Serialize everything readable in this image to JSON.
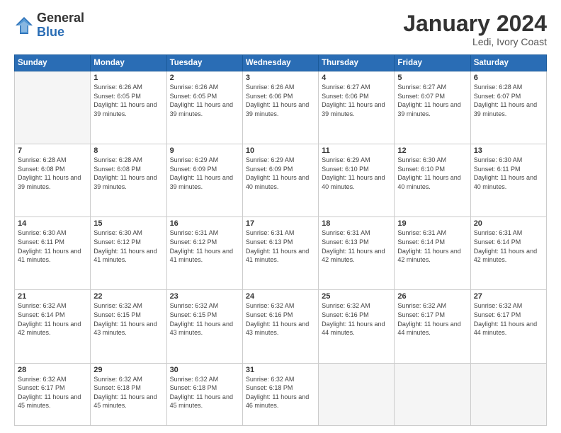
{
  "header": {
    "logo_general": "General",
    "logo_blue": "Blue",
    "month_title": "January 2024",
    "location": "Ledi, Ivory Coast"
  },
  "weekdays": [
    "Sunday",
    "Monday",
    "Tuesday",
    "Wednesday",
    "Thursday",
    "Friday",
    "Saturday"
  ],
  "weeks": [
    [
      {
        "day": "",
        "empty": true
      },
      {
        "day": "1",
        "sunrise": "Sunrise: 6:26 AM",
        "sunset": "Sunset: 6:05 PM",
        "daylight": "Daylight: 11 hours and 39 minutes."
      },
      {
        "day": "2",
        "sunrise": "Sunrise: 6:26 AM",
        "sunset": "Sunset: 6:05 PM",
        "daylight": "Daylight: 11 hours and 39 minutes."
      },
      {
        "day": "3",
        "sunrise": "Sunrise: 6:26 AM",
        "sunset": "Sunset: 6:06 PM",
        "daylight": "Daylight: 11 hours and 39 minutes."
      },
      {
        "day": "4",
        "sunrise": "Sunrise: 6:27 AM",
        "sunset": "Sunset: 6:06 PM",
        "daylight": "Daylight: 11 hours and 39 minutes."
      },
      {
        "day": "5",
        "sunrise": "Sunrise: 6:27 AM",
        "sunset": "Sunset: 6:07 PM",
        "daylight": "Daylight: 11 hours and 39 minutes."
      },
      {
        "day": "6",
        "sunrise": "Sunrise: 6:28 AM",
        "sunset": "Sunset: 6:07 PM",
        "daylight": "Daylight: 11 hours and 39 minutes."
      }
    ],
    [
      {
        "day": "7",
        "sunrise": "Sunrise: 6:28 AM",
        "sunset": "Sunset: 6:08 PM",
        "daylight": "Daylight: 11 hours and 39 minutes."
      },
      {
        "day": "8",
        "sunrise": "Sunrise: 6:28 AM",
        "sunset": "Sunset: 6:08 PM",
        "daylight": "Daylight: 11 hours and 39 minutes."
      },
      {
        "day": "9",
        "sunrise": "Sunrise: 6:29 AM",
        "sunset": "Sunset: 6:09 PM",
        "daylight": "Daylight: 11 hours and 39 minutes."
      },
      {
        "day": "10",
        "sunrise": "Sunrise: 6:29 AM",
        "sunset": "Sunset: 6:09 PM",
        "daylight": "Daylight: 11 hours and 40 minutes."
      },
      {
        "day": "11",
        "sunrise": "Sunrise: 6:29 AM",
        "sunset": "Sunset: 6:10 PM",
        "daylight": "Daylight: 11 hours and 40 minutes."
      },
      {
        "day": "12",
        "sunrise": "Sunrise: 6:30 AM",
        "sunset": "Sunset: 6:10 PM",
        "daylight": "Daylight: 11 hours and 40 minutes."
      },
      {
        "day": "13",
        "sunrise": "Sunrise: 6:30 AM",
        "sunset": "Sunset: 6:11 PM",
        "daylight": "Daylight: 11 hours and 40 minutes."
      }
    ],
    [
      {
        "day": "14",
        "sunrise": "Sunrise: 6:30 AM",
        "sunset": "Sunset: 6:11 PM",
        "daylight": "Daylight: 11 hours and 41 minutes."
      },
      {
        "day": "15",
        "sunrise": "Sunrise: 6:30 AM",
        "sunset": "Sunset: 6:12 PM",
        "daylight": "Daylight: 11 hours and 41 minutes."
      },
      {
        "day": "16",
        "sunrise": "Sunrise: 6:31 AM",
        "sunset": "Sunset: 6:12 PM",
        "daylight": "Daylight: 11 hours and 41 minutes."
      },
      {
        "day": "17",
        "sunrise": "Sunrise: 6:31 AM",
        "sunset": "Sunset: 6:13 PM",
        "daylight": "Daylight: 11 hours and 41 minutes."
      },
      {
        "day": "18",
        "sunrise": "Sunrise: 6:31 AM",
        "sunset": "Sunset: 6:13 PM",
        "daylight": "Daylight: 11 hours and 42 minutes."
      },
      {
        "day": "19",
        "sunrise": "Sunrise: 6:31 AM",
        "sunset": "Sunset: 6:14 PM",
        "daylight": "Daylight: 11 hours and 42 minutes."
      },
      {
        "day": "20",
        "sunrise": "Sunrise: 6:31 AM",
        "sunset": "Sunset: 6:14 PM",
        "daylight": "Daylight: 11 hours and 42 minutes."
      }
    ],
    [
      {
        "day": "21",
        "sunrise": "Sunrise: 6:32 AM",
        "sunset": "Sunset: 6:14 PM",
        "daylight": "Daylight: 11 hours and 42 minutes."
      },
      {
        "day": "22",
        "sunrise": "Sunrise: 6:32 AM",
        "sunset": "Sunset: 6:15 PM",
        "daylight": "Daylight: 11 hours and 43 minutes."
      },
      {
        "day": "23",
        "sunrise": "Sunrise: 6:32 AM",
        "sunset": "Sunset: 6:15 PM",
        "daylight": "Daylight: 11 hours and 43 minutes."
      },
      {
        "day": "24",
        "sunrise": "Sunrise: 6:32 AM",
        "sunset": "Sunset: 6:16 PM",
        "daylight": "Daylight: 11 hours and 43 minutes."
      },
      {
        "day": "25",
        "sunrise": "Sunrise: 6:32 AM",
        "sunset": "Sunset: 6:16 PM",
        "daylight": "Daylight: 11 hours and 44 minutes."
      },
      {
        "day": "26",
        "sunrise": "Sunrise: 6:32 AM",
        "sunset": "Sunset: 6:17 PM",
        "daylight": "Daylight: 11 hours and 44 minutes."
      },
      {
        "day": "27",
        "sunrise": "Sunrise: 6:32 AM",
        "sunset": "Sunset: 6:17 PM",
        "daylight": "Daylight: 11 hours and 44 minutes."
      }
    ],
    [
      {
        "day": "28",
        "sunrise": "Sunrise: 6:32 AM",
        "sunset": "Sunset: 6:17 PM",
        "daylight": "Daylight: 11 hours and 45 minutes."
      },
      {
        "day": "29",
        "sunrise": "Sunrise: 6:32 AM",
        "sunset": "Sunset: 6:18 PM",
        "daylight": "Daylight: 11 hours and 45 minutes."
      },
      {
        "day": "30",
        "sunrise": "Sunrise: 6:32 AM",
        "sunset": "Sunset: 6:18 PM",
        "daylight": "Daylight: 11 hours and 45 minutes."
      },
      {
        "day": "31",
        "sunrise": "Sunrise: 6:32 AM",
        "sunset": "Sunset: 6:18 PM",
        "daylight": "Daylight: 11 hours and 46 minutes."
      },
      {
        "day": "",
        "empty": true
      },
      {
        "day": "",
        "empty": true
      },
      {
        "day": "",
        "empty": true
      }
    ]
  ]
}
